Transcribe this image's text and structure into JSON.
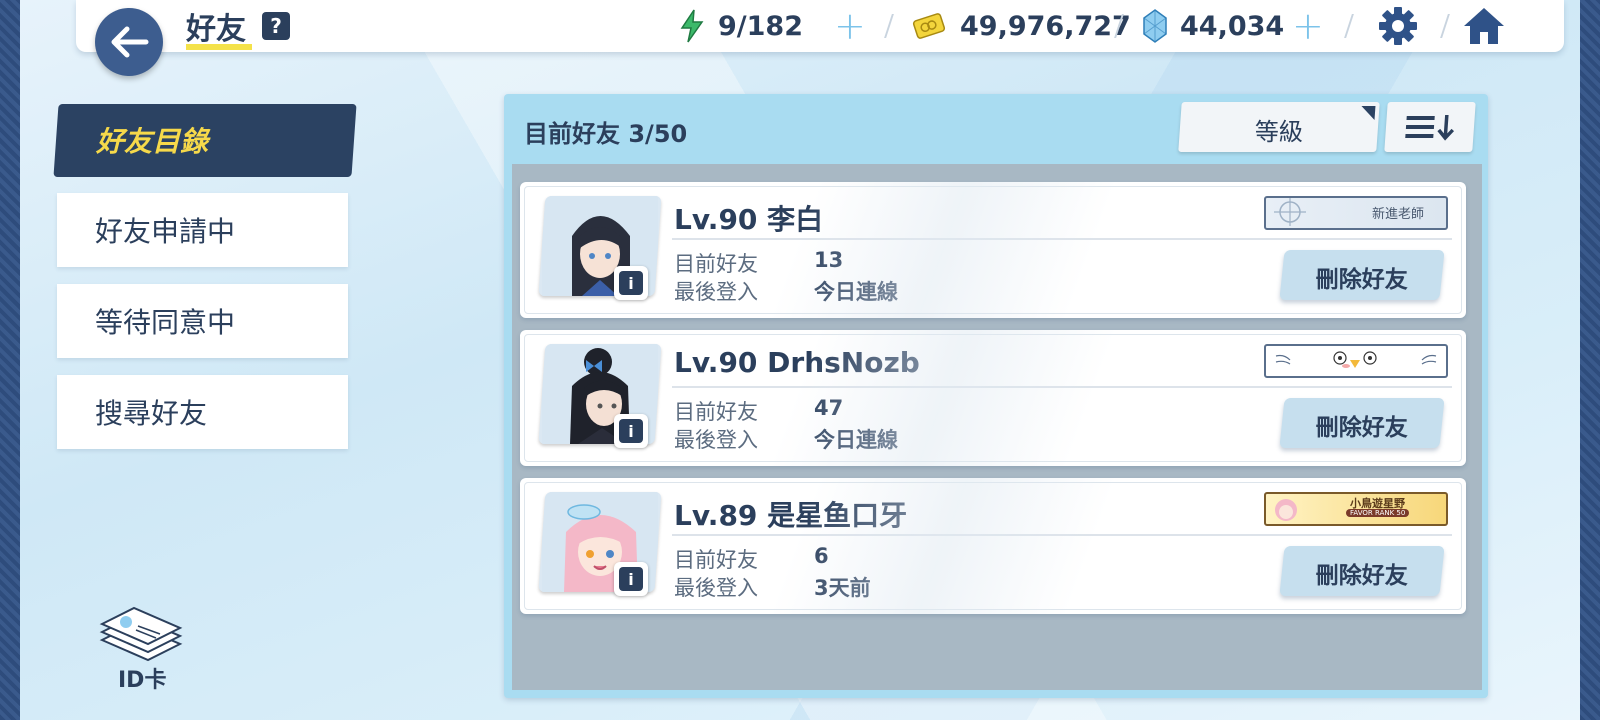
{
  "header": {
    "title": "好友",
    "help_icon": "?",
    "ap": "9/182",
    "credits": "49,976,727",
    "pyroxene": "44,034",
    "colors": {
      "accent": "#2b3f5c",
      "highlight": "#f4e24a",
      "plus": "#7cc3ea"
    }
  },
  "sidebar": {
    "items": [
      {
        "label": "好友目錄",
        "active": true
      },
      {
        "label": "好友申請中",
        "active": false
      },
      {
        "label": "等待同意中",
        "active": false
      },
      {
        "label": "搜尋好友",
        "active": false
      }
    ],
    "id_card_label": "ID卡"
  },
  "panel": {
    "title": "目前好友  3/50",
    "sort_label": "等級"
  },
  "friends": [
    {
      "name": "Lv.90 李白",
      "friend_label": "目前好友",
      "friend_count": "13",
      "login_label": "最後登入",
      "last_login": "今日連線",
      "badge_text": "新進老師",
      "button": "刪除好友"
    },
    {
      "name": "Lv.90 DrhsNozb",
      "friend_label": "目前好友",
      "friend_count": "47",
      "login_label": "最後登入",
      "last_login": "今日連線",
      "badge_text": "",
      "button": "刪除好友"
    },
    {
      "name": "Lv.89 是星鱼口牙",
      "friend_label": "目前好友",
      "friend_count": "6",
      "login_label": "最後登入",
      "last_login": "3天前",
      "badge_text": "小鳥遊星野",
      "badge_sub": "FAVOR RANK 50",
      "button": "刪除好友"
    }
  ]
}
